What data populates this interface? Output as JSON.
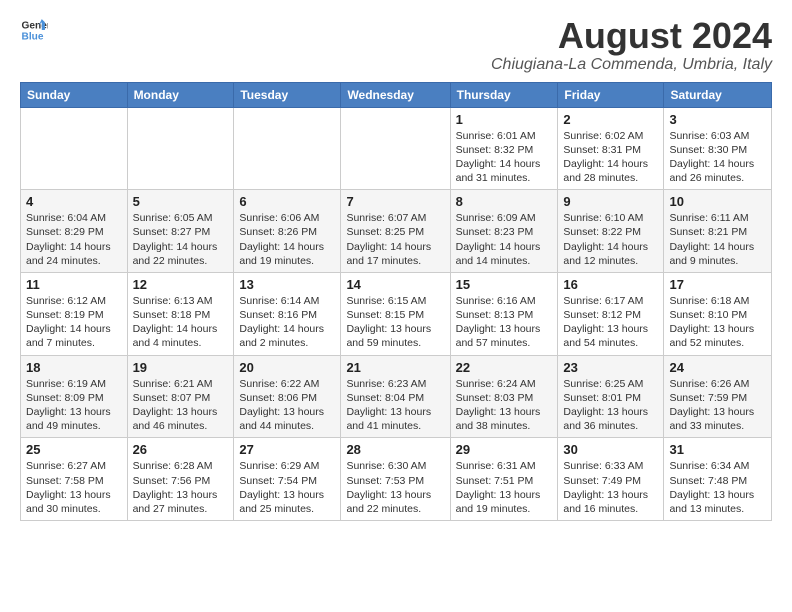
{
  "header": {
    "logo_line1": "General",
    "logo_line2": "Blue",
    "title": "August 2024",
    "subtitle": "Chiugiana-La Commenda, Umbria, Italy"
  },
  "days_of_week": [
    "Sunday",
    "Monday",
    "Tuesday",
    "Wednesday",
    "Thursday",
    "Friday",
    "Saturday"
  ],
  "weeks": [
    [
      {
        "day": "",
        "text": ""
      },
      {
        "day": "",
        "text": ""
      },
      {
        "day": "",
        "text": ""
      },
      {
        "day": "",
        "text": ""
      },
      {
        "day": "1",
        "text": "Sunrise: 6:01 AM\nSunset: 8:32 PM\nDaylight: 14 hours\nand 31 minutes."
      },
      {
        "day": "2",
        "text": "Sunrise: 6:02 AM\nSunset: 8:31 PM\nDaylight: 14 hours\nand 28 minutes."
      },
      {
        "day": "3",
        "text": "Sunrise: 6:03 AM\nSunset: 8:30 PM\nDaylight: 14 hours\nand 26 minutes."
      }
    ],
    [
      {
        "day": "4",
        "text": "Sunrise: 6:04 AM\nSunset: 8:29 PM\nDaylight: 14 hours\nand 24 minutes."
      },
      {
        "day": "5",
        "text": "Sunrise: 6:05 AM\nSunset: 8:27 PM\nDaylight: 14 hours\nand 22 minutes."
      },
      {
        "day": "6",
        "text": "Sunrise: 6:06 AM\nSunset: 8:26 PM\nDaylight: 14 hours\nand 19 minutes."
      },
      {
        "day": "7",
        "text": "Sunrise: 6:07 AM\nSunset: 8:25 PM\nDaylight: 14 hours\nand 17 minutes."
      },
      {
        "day": "8",
        "text": "Sunrise: 6:09 AM\nSunset: 8:23 PM\nDaylight: 14 hours\nand 14 minutes."
      },
      {
        "day": "9",
        "text": "Sunrise: 6:10 AM\nSunset: 8:22 PM\nDaylight: 14 hours\nand 12 minutes."
      },
      {
        "day": "10",
        "text": "Sunrise: 6:11 AM\nSunset: 8:21 PM\nDaylight: 14 hours\nand 9 minutes."
      }
    ],
    [
      {
        "day": "11",
        "text": "Sunrise: 6:12 AM\nSunset: 8:19 PM\nDaylight: 14 hours\nand 7 minutes."
      },
      {
        "day": "12",
        "text": "Sunrise: 6:13 AM\nSunset: 8:18 PM\nDaylight: 14 hours\nand 4 minutes."
      },
      {
        "day": "13",
        "text": "Sunrise: 6:14 AM\nSunset: 8:16 PM\nDaylight: 14 hours\nand 2 minutes."
      },
      {
        "day": "14",
        "text": "Sunrise: 6:15 AM\nSunset: 8:15 PM\nDaylight: 13 hours\nand 59 minutes."
      },
      {
        "day": "15",
        "text": "Sunrise: 6:16 AM\nSunset: 8:13 PM\nDaylight: 13 hours\nand 57 minutes."
      },
      {
        "day": "16",
        "text": "Sunrise: 6:17 AM\nSunset: 8:12 PM\nDaylight: 13 hours\nand 54 minutes."
      },
      {
        "day": "17",
        "text": "Sunrise: 6:18 AM\nSunset: 8:10 PM\nDaylight: 13 hours\nand 52 minutes."
      }
    ],
    [
      {
        "day": "18",
        "text": "Sunrise: 6:19 AM\nSunset: 8:09 PM\nDaylight: 13 hours\nand 49 minutes."
      },
      {
        "day": "19",
        "text": "Sunrise: 6:21 AM\nSunset: 8:07 PM\nDaylight: 13 hours\nand 46 minutes."
      },
      {
        "day": "20",
        "text": "Sunrise: 6:22 AM\nSunset: 8:06 PM\nDaylight: 13 hours\nand 44 minutes."
      },
      {
        "day": "21",
        "text": "Sunrise: 6:23 AM\nSunset: 8:04 PM\nDaylight: 13 hours\nand 41 minutes."
      },
      {
        "day": "22",
        "text": "Sunrise: 6:24 AM\nSunset: 8:03 PM\nDaylight: 13 hours\nand 38 minutes."
      },
      {
        "day": "23",
        "text": "Sunrise: 6:25 AM\nSunset: 8:01 PM\nDaylight: 13 hours\nand 36 minutes."
      },
      {
        "day": "24",
        "text": "Sunrise: 6:26 AM\nSunset: 7:59 PM\nDaylight: 13 hours\nand 33 minutes."
      }
    ],
    [
      {
        "day": "25",
        "text": "Sunrise: 6:27 AM\nSunset: 7:58 PM\nDaylight: 13 hours\nand 30 minutes."
      },
      {
        "day": "26",
        "text": "Sunrise: 6:28 AM\nSunset: 7:56 PM\nDaylight: 13 hours\nand 27 minutes."
      },
      {
        "day": "27",
        "text": "Sunrise: 6:29 AM\nSunset: 7:54 PM\nDaylight: 13 hours\nand 25 minutes."
      },
      {
        "day": "28",
        "text": "Sunrise: 6:30 AM\nSunset: 7:53 PM\nDaylight: 13 hours\nand 22 minutes."
      },
      {
        "day": "29",
        "text": "Sunrise: 6:31 AM\nSunset: 7:51 PM\nDaylight: 13 hours\nand 19 minutes."
      },
      {
        "day": "30",
        "text": "Sunrise: 6:33 AM\nSunset: 7:49 PM\nDaylight: 13 hours\nand 16 minutes."
      },
      {
        "day": "31",
        "text": "Sunrise: 6:34 AM\nSunset: 7:48 PM\nDaylight: 13 hours\nand 13 minutes."
      }
    ]
  ]
}
